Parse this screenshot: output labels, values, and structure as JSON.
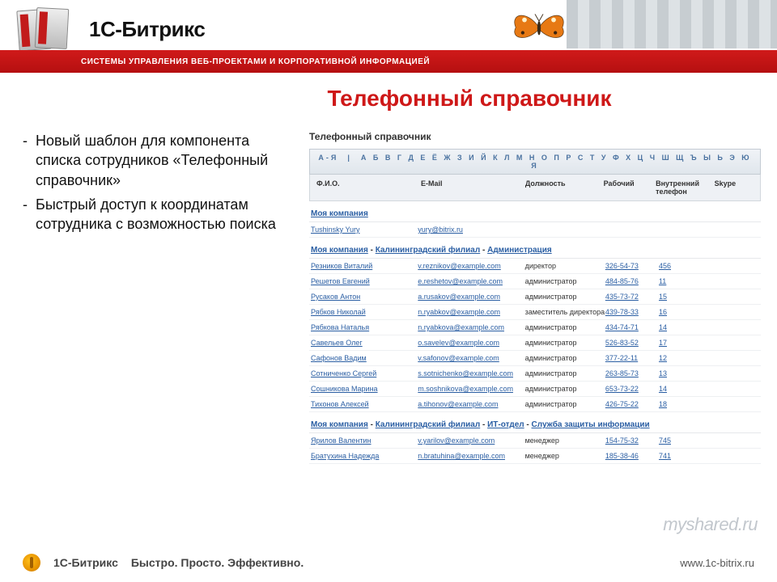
{
  "header": {
    "brand": "1С-Битрикс",
    "tagline": "СИСТЕМЫ УПРАВЛЕНИЯ ВЕБ-ПРОЕКТАМИ И КОРПОРАТИВНОЙ ИНФОРМАЦИЕЙ"
  },
  "main": {
    "title": "Телефонный справочник",
    "bullets": [
      "Новый шаблон для компонента списка сотрудников «Телефонный справочник»",
      "Быстрый доступ к координатам сотрудника с возможностью поиска"
    ],
    "panel": {
      "title": "Телефонный справочник",
      "alpha_all": "А-Я",
      "alpha_letters": "А Б В Г Д Е Ё Ж З И Й К Л М Н О П Р С Т У Ф Х Ц Ч Ш Щ Ъ Ы Ь Э Ю Я",
      "columns": {
        "name": "Ф.И.О.",
        "email": "E-Mail",
        "position": "Должность",
        "work": "Рабочий",
        "ext": "Внутренний телефон",
        "skype": "Skype"
      },
      "groups": [
        {
          "crumbs": [
            "Моя компания"
          ],
          "rows": [
            {
              "name": "Tushinsky Yury",
              "email": "yury@bitrix.ru",
              "pos": "",
              "work": "",
              "ext": "",
              "skype": ""
            }
          ]
        },
        {
          "crumbs": [
            "Моя компания",
            "Калининградский филиал",
            "Администрация"
          ],
          "rows": [
            {
              "name": "Резников Виталий",
              "email": "v.reznikov@example.com",
              "pos": "директор",
              "work": "326-54-73",
              "ext": "456",
              "skype": ""
            },
            {
              "name": "Решетов Евгений",
              "email": "e.reshetov@example.com",
              "pos": "администратор",
              "work": "484-85-76",
              "ext": "11",
              "skype": ""
            },
            {
              "name": "Русаков Антон",
              "email": "a.rusakov@example.com",
              "pos": "администратор",
              "work": "435-73-72",
              "ext": "15",
              "skype": ""
            },
            {
              "name": "Рябков Николай",
              "email": "n.ryabkov@example.com",
              "pos": "заместитель директора",
              "work": "439-78-33",
              "ext": "16",
              "skype": ""
            },
            {
              "name": "Рябкова Наталья",
              "email": "n.ryabkova@example.com",
              "pos": "администратор",
              "work": "434-74-71",
              "ext": "14",
              "skype": ""
            },
            {
              "name": "Савельев Олег",
              "email": "o.savelev@example.com",
              "pos": "администратор",
              "work": "526-83-52",
              "ext": "17",
              "skype": ""
            },
            {
              "name": "Сафонов Вадим",
              "email": "v.safonov@example.com",
              "pos": "администратор",
              "work": "377-22-11",
              "ext": "12",
              "skype": ""
            },
            {
              "name": "Сотниченко Сергей",
              "email": "s.sotnichenko@example.com",
              "pos": "администратор",
              "work": "263-85-73",
              "ext": "13",
              "skype": ""
            },
            {
              "name": "Сошникова Марина",
              "email": "m.soshnikova@example.com",
              "pos": "администратор",
              "work": "653-73-22",
              "ext": "14",
              "skype": ""
            },
            {
              "name": "Тихонов Алексей",
              "email": "a.tihonov@example.com",
              "pos": "администратор",
              "work": "426-75-22",
              "ext": "18",
              "skype": ""
            }
          ]
        },
        {
          "crumbs": [
            "Моя компания",
            "Калининградский филиал",
            "ИТ-отдел",
            "Служба защиты информации"
          ],
          "rows": [
            {
              "name": "Ярилов Валентин",
              "email": "v.yarilov@example.com",
              "pos": "менеджер",
              "work": "154-75-32",
              "ext": "745",
              "skype": ""
            },
            {
              "name": "Братухина Надежда",
              "email": "n.bratuhina@example.com",
              "pos": "менеджер",
              "work": "185-38-46",
              "ext": "741",
              "skype": ""
            }
          ]
        }
      ]
    }
  },
  "footer": {
    "brand": "1С-Битрикс",
    "slogan": "Быстро. Просто. Эффективно.",
    "url": "www.1c-bitrix.ru"
  },
  "watermark": "myshared.ru"
}
